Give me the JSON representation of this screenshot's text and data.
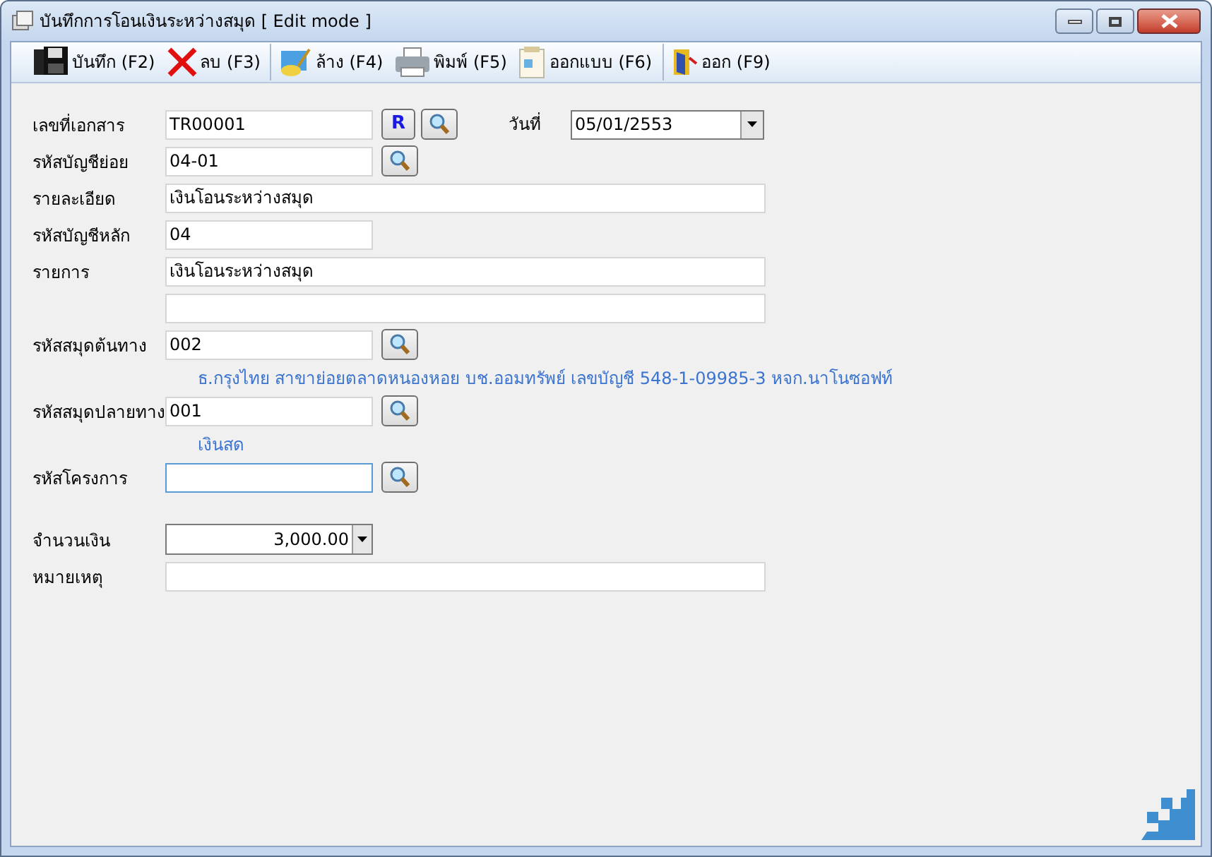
{
  "window": {
    "title": "บันทึกการโอนเงินระหว่างสมุด [ Edit mode ]"
  },
  "toolbar": [
    [
      {
        "kind": "save",
        "label": "บันทึก (F2)"
      },
      {
        "kind": "delete",
        "label": "ลบ (F3)"
      }
    ],
    [
      {
        "kind": "clear",
        "label": "ล้าง (F4)"
      },
      {
        "kind": "print",
        "label": "พิมพ์ (F5)"
      },
      {
        "kind": "form",
        "label": "ออกแบบ (F6)"
      }
    ],
    [
      {
        "kind": "exit",
        "label": "ออก (F9)"
      }
    ]
  ],
  "form": {
    "rows": [
      {
        "kind": "short",
        "label": "เลขที่เอกสาร",
        "value": "TR00001",
        "focused": false,
        "buttons": [
          {
            "kind": "refresh",
            "label": "R"
          },
          {
            "kind": "lookup"
          }
        ],
        "side": {
          "label": "วันที่",
          "value": "05/01/2553"
        }
      },
      {
        "kind": "short",
        "label": "รหัสบัญชีย่อย",
        "value": "04-01",
        "focused": false,
        "buttons": [
          {
            "kind": "lookup"
          }
        ]
      },
      {
        "kind": "long",
        "label": "รายละเอียด",
        "value": "เงินโอนระหว่างสมุด",
        "focused": false
      },
      {
        "kind": "short",
        "label": "รหัสบัญชีหลัก",
        "value": "04",
        "focused": false
      },
      {
        "kind": "long",
        "label": "รายการ",
        "value": "เงินโอนระหว่างสมุด",
        "focused": false
      },
      {
        "kind": "long",
        "focused": false
      },
      {
        "kind": "short",
        "label": "รหัสสมุดต้นทาง",
        "value": "002",
        "focused": false,
        "buttons": [
          {
            "kind": "lookup"
          }
        ]
      },
      {
        "kind": "note",
        "text": "ธ.กรุงไทย สาขาย่อยตลาดหนองหอย  บช.ออมทรัพย์ เลขบัญชี 548-1-09985-3 หจก.นาโนซอฟท์"
      },
      {
        "kind": "short",
        "label": "รหัสสมุดปลายทาง",
        "value": "001",
        "focused": false,
        "buttons": [
          {
            "kind": "lookup"
          }
        ]
      },
      {
        "kind": "note",
        "text": "เงินสด"
      },
      {
        "kind": "short",
        "label": "รหัสโครงการ",
        "focused": true,
        "buttons": [
          {
            "kind": "lookup"
          }
        ]
      },
      {
        "kind": "amount",
        "label": "จำนวนเงิน",
        "value": "3,000.00"
      },
      {
        "kind": "long",
        "label": "หมายเหตุ",
        "focused": false
      }
    ]
  }
}
